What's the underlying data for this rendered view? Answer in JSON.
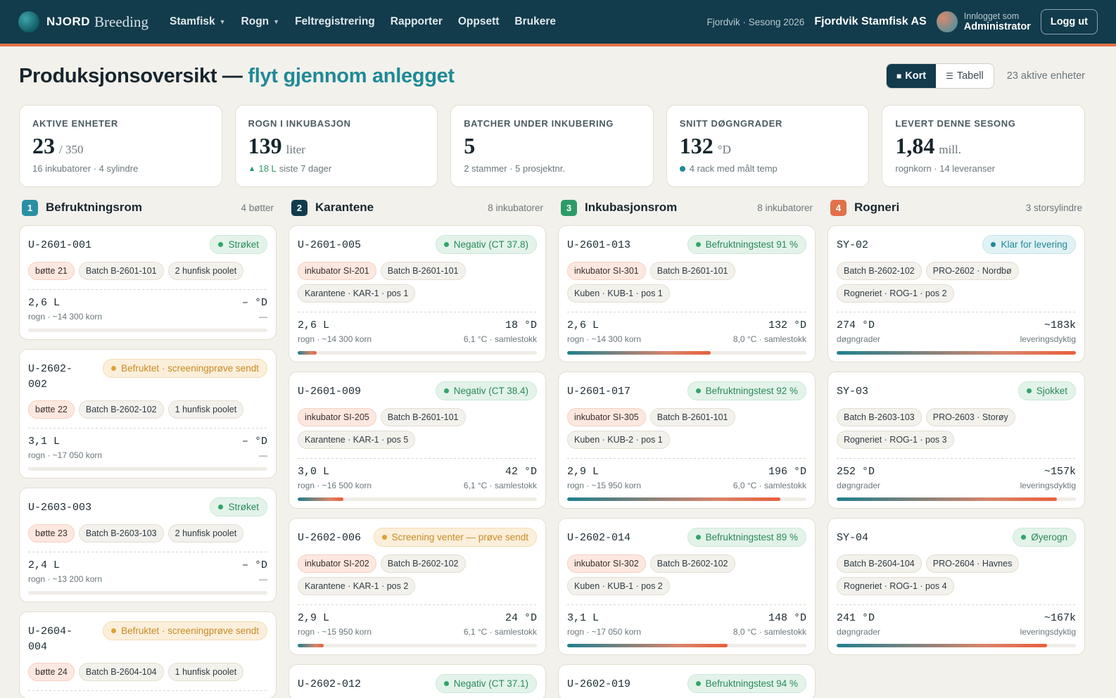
{
  "brand": {
    "name": "NJORD",
    "sub": "Breeding"
  },
  "nav": [
    "Stamfisk",
    "Rogn",
    "Feltregistrering",
    "Rapporter",
    "Oppsett",
    "Brukere"
  ],
  "header": {
    "season": "Fjordvik · Sesong 2026",
    "company": "Fjordvik Stamfisk AS",
    "user_label": "Innlogget som",
    "user_role": "Administrator",
    "logout": "Logg ut"
  },
  "title": {
    "main": "Produksjonsoversikt —",
    "accent": "flyt gjennom anlegget"
  },
  "view": {
    "kort": "Kort",
    "tabell": "Tabell",
    "active_count": "23 aktive enheter"
  },
  "stats": [
    {
      "label": "AKTIVE ENHETER",
      "value": "23",
      "unit": "/ 350",
      "sub": "16 inkubatorer · 4 sylindre"
    },
    {
      "label": "ROGN I INKUBASJON",
      "value": "139",
      "unit": "liter",
      "sub_up": "18 L",
      "sub": "siste 7 dager"
    },
    {
      "label": "BATCHER UNDER INKUBERING",
      "value": "5",
      "unit": "",
      "sub": "2 stammer · 5 prosjektnr."
    },
    {
      "label": "SNITT DØGNGRADER",
      "value": "132",
      "unit": "°D",
      "sub": "4 rack med målt temp"
    },
    {
      "label": "LEVERT DENNE SESONG",
      "value": "1,84",
      "unit": "mill.",
      "sub": "rognkorn · 14 leveranser"
    }
  ],
  "colors": {
    "accent": "#1f8a96",
    "navy": "#123b4c",
    "orange": "#e2714a",
    "col2": "#123b4c",
    "col3": "#2e9b6a"
  },
  "columns": [
    {
      "num": "1",
      "title": "Befruktningsrom",
      "count": "4 bøtter",
      "color": "#2a8fa3",
      "cards": [
        {
          "id": "U-2601-001",
          "badge": "Strøket",
          "tone": "green",
          "tags": [
            [
              "bøtte 21",
              "salmon"
            ],
            [
              "Batch B-2601-101",
              ""
            ],
            [
              "2 hunfisk poolet",
              ""
            ]
          ],
          "lv": "2,6 L",
          "ls": "rogn · ~14 300 korn",
          "rv": "– °D",
          "rs": "—",
          "p": 0
        },
        {
          "id": "U-2602-002",
          "badge": "Befruktet · screeningprøve sendt",
          "tone": "amber",
          "tags": [
            [
              "bøtte 22",
              "salmon"
            ],
            [
              "Batch B-2602-102",
              ""
            ],
            [
              "1 hunfisk poolet",
              ""
            ]
          ],
          "lv": "3,1 L",
          "ls": "rogn · ~17 050 korn",
          "rv": "– °D",
          "rs": "—",
          "p": 0
        },
        {
          "id": "U-2603-003",
          "badge": "Strøket",
          "tone": "green",
          "tags": [
            [
              "bøtte 23",
              "salmon"
            ],
            [
              "Batch B-2603-103",
              ""
            ],
            [
              "2 hunfisk poolet",
              ""
            ]
          ],
          "lv": "2,4 L",
          "ls": "rogn · ~13 200 korn",
          "rv": "– °D",
          "rs": "—",
          "p": 0
        },
        {
          "id": "U-2604-004",
          "badge": "Befruktet · screeningprøve sendt",
          "tone": "amber",
          "tags": [
            [
              "bøtte 24",
              "salmon"
            ],
            [
              "Batch B-2604-104",
              ""
            ],
            [
              "1 hunfisk poolet",
              ""
            ]
          ],
          "lv": "",
          "ls": "",
          "rv": "",
          "rs": "",
          "p": 0
        }
      ]
    },
    {
      "num": "2",
      "title": "Karantene",
      "count": "8 inkubatorer",
      "color": "#123b4c",
      "cards": [
        {
          "id": "U-2601-005",
          "badge": "Negativ (CT 37.8)",
          "tone": "green",
          "tags": [
            [
              "inkubator SI-201",
              "salmon"
            ],
            [
              "Batch B-2601-101",
              ""
            ],
            [
              "Karantene · KAR-1 · pos 1",
              ""
            ]
          ],
          "lv": "2,6 L",
          "ls": "rogn · ~14 300 korn",
          "rv": "18 °D",
          "rs": "6,1 °C · samlestokk",
          "p": 0.08
        },
        {
          "id": "U-2601-009",
          "badge": "Negativ (CT 38.4)",
          "tone": "green",
          "tags": [
            [
              "inkubator SI-205",
              "salmon"
            ],
            [
              "Batch B-2601-101",
              ""
            ],
            [
              "Karantene · KAR-1 · pos 5",
              ""
            ]
          ],
          "lv": "3,0 L",
          "ls": "rogn · ~16 500 korn",
          "rv": "42 °D",
          "rs": "6,1 °C · samlestokk",
          "p": 0.19
        },
        {
          "id": "U-2602-006",
          "badge": "Screening venter — prøve sendt",
          "tone": "amber",
          "tags": [
            [
              "inkubator SI-202",
              "salmon"
            ],
            [
              "Batch B-2602-102",
              ""
            ],
            [
              "Karantene · KAR-1 · pos 2",
              ""
            ]
          ],
          "lv": "2,9 L",
          "ls": "rogn · ~15 950 korn",
          "rv": "24 °D",
          "rs": "6,1 °C · samlestokk",
          "p": 0.11
        },
        {
          "id": "U-2602-012",
          "badge": "Negativ (CT 37.1)",
          "tone": "green",
          "tags": [],
          "lv": "",
          "ls": "",
          "rv": "",
          "rs": "",
          "p": 0
        }
      ]
    },
    {
      "num": "3",
      "title": "Inkubasjonsrom",
      "count": "8 inkubatorer",
      "color": "#2e9b6a",
      "cards": [
        {
          "id": "U-2601-013",
          "badge": "Befruktningstest 91 %",
          "tone": "green",
          "tags": [
            [
              "inkubator SI-301",
              "salmon"
            ],
            [
              "Batch B-2601-101",
              ""
            ],
            [
              "Kuben · KUB-1 · pos 1",
              ""
            ]
          ],
          "lv": "2,6 L",
          "ls": "rogn · ~14 300 korn",
          "rv": "132 °D",
          "rs": "8,0 °C · samlestokk",
          "p": 0.6
        },
        {
          "id": "U-2601-017",
          "badge": "Befruktningstest 92 %",
          "tone": "green",
          "tags": [
            [
              "inkubator SI-305",
              "salmon"
            ],
            [
              "Batch B-2601-101",
              ""
            ],
            [
              "Kuben · KUB-2 · pos 1",
              ""
            ]
          ],
          "lv": "2,9 L",
          "ls": "rogn · ~15 950 korn",
          "rv": "196 °D",
          "rs": "6,0 °C · samlestokk",
          "p": 0.89
        },
        {
          "id": "U-2602-014",
          "badge": "Befruktningstest 89 %",
          "tone": "green",
          "tags": [
            [
              "inkubator SI-302",
              "salmon"
            ],
            [
              "Batch B-2602-102",
              ""
            ],
            [
              "Kuben · KUB-1 · pos 2",
              ""
            ]
          ],
          "lv": "3,1 L",
          "ls": "rogn · ~17 050 korn",
          "rv": "148 °D",
          "rs": "8,0 °C · samlestokk",
          "p": 0.67
        },
        {
          "id": "U-2602-019",
          "badge": "Befruktningstest 94 %",
          "tone": "green",
          "tags": [],
          "lv": "",
          "ls": "",
          "rv": "",
          "rs": "",
          "p": 0
        }
      ]
    },
    {
      "num": "4",
      "title": "Rogneri",
      "count": "3 storsylindre",
      "color": "#e2714a",
      "cards": [
        {
          "id": "SY-02",
          "badge": "Klar for levering",
          "tone": "blue",
          "tags": [
            [
              "Batch B-2602-102",
              ""
            ],
            [
              "PRO-2602 · Nordbø",
              ""
            ],
            [
              "Rogneriet · ROG-1 · pos 2",
              ""
            ]
          ],
          "lv": "274 °D",
          "ls": "døgngrader",
          "rv": "~183k",
          "rs": "leveringsdyktig",
          "p": 1.0
        },
        {
          "id": "SY-03",
          "badge": "Sjokket",
          "tone": "green",
          "tags": [
            [
              "Batch B-2603-103",
              ""
            ],
            [
              "PRO-2603 · Storøy",
              ""
            ],
            [
              "Rogneriet · ROG-1 · pos 3",
              ""
            ]
          ],
          "lv": "252 °D",
          "ls": "døgngrader",
          "rv": "~157k",
          "rs": "leveringsdyktig",
          "p": 0.92
        },
        {
          "id": "SY-04",
          "badge": "Øyerogn",
          "tone": "green",
          "tags": [
            [
              "Batch B-2604-104",
              ""
            ],
            [
              "PRO-2604 · Havnes",
              ""
            ],
            [
              "Rogneriet · ROG-1 · pos 4",
              ""
            ]
          ],
          "lv": "241 °D",
          "ls": "døgngrader",
          "rv": "~167k",
          "rs": "leveringsdyktig",
          "p": 0.88
        }
      ]
    }
  ]
}
